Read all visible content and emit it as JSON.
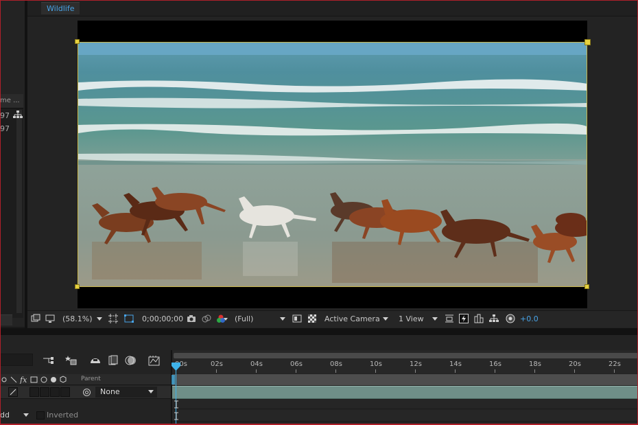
{
  "composition": {
    "tab_label": "Wildlife"
  },
  "project_panel": {
    "column_header": "me ...",
    "rows": [
      "97",
      "97"
    ]
  },
  "viewer_toolbar": {
    "magnification": "(58.1%)",
    "timecode": "0;00;00;00",
    "resolution": "(Full)",
    "camera": "Active Camera",
    "view_layout": "1 View",
    "exposure": "+0.0"
  },
  "timeline": {
    "ruler_ticks": [
      "00s",
      "02s",
      "04s",
      "06s",
      "08s",
      "10s",
      "12s",
      "14s",
      "16s",
      "18s",
      "20s",
      "22s"
    ],
    "parent_header": "Parent",
    "parent_value": "None",
    "mask_mode": "dd",
    "inverted_label": "Inverted"
  },
  "colors": {
    "tab_text": "#48a4e8",
    "exposure_text": "#48a4e8",
    "cti": "#3fb3ea",
    "layer_bar": "#6f8f88",
    "handles": "#e6d13f",
    "frame_border": "#b0202a"
  }
}
